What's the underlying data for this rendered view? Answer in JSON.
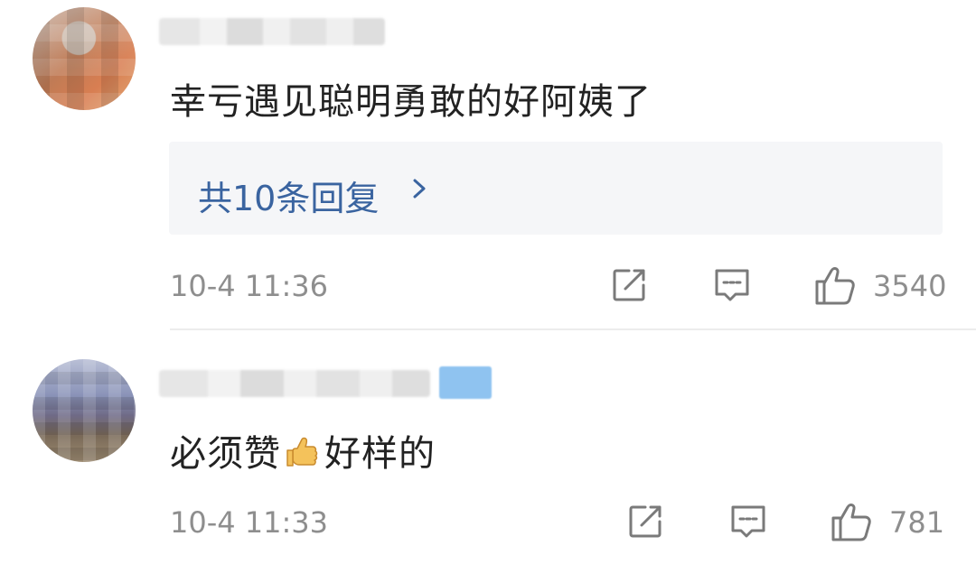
{
  "comments": [
    {
      "text": "幸亏遇见聪明勇敢的好阿姨了",
      "reply_label": "共10条回复",
      "timestamp": "10-4 11:36",
      "like_count": "3540",
      "icons": {
        "share": "share-icon",
        "comment": "comment-icon",
        "like": "thumbs-up-icon"
      }
    },
    {
      "text_before": "必须赞",
      "emoji": "thumbs-up-emoji",
      "text_after": "好样的",
      "timestamp": "10-4 11:33",
      "like_count": "781",
      "icons": {
        "share": "share-icon",
        "comment": "comment-icon",
        "like": "thumbs-up-icon"
      }
    }
  ],
  "colors": {
    "text": "#222222",
    "meta": "#8e8e8e",
    "reply_link": "#3a64a0",
    "reply_bg": "#f5f6f8",
    "divider": "#ececec",
    "badge": "#8fc3f0"
  }
}
